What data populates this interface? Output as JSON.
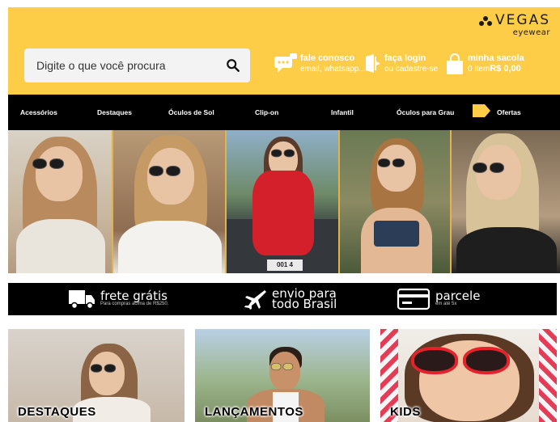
{
  "brand": {
    "name": "VEGAS",
    "tagline": "eyewear"
  },
  "search": {
    "placeholder": "Digite o que você procura"
  },
  "header_items": {
    "contact": {
      "title": "fale conosco",
      "subtitle": "email, whatsapp..."
    },
    "login": {
      "title": "faça login",
      "subtitle": "ou cadastre-se"
    },
    "bag": {
      "title": "minha sacola",
      "count": "0 item",
      "total": "R$ 0,00"
    }
  },
  "nav": {
    "items": [
      "Acessórios",
      "Destaques",
      "Óculos de Sol",
      "Clip-on",
      "Infantil",
      "Óculos para Grau",
      "Ofertas"
    ]
  },
  "banner": {
    "plate_text": "001 4"
  },
  "promo": {
    "free_shipping": {
      "title": "frete grátis",
      "subtitle": "Para compras acima de R$250."
    },
    "shipping": {
      "title_line1": "envio para",
      "title_line2": "todo Brasil"
    },
    "installments": {
      "title": "parcele",
      "subtitle": "em até 5x"
    }
  },
  "categories": [
    "DESTAQUES",
    "LANÇAMENTOS",
    "KIDS"
  ],
  "colors": {
    "header_bg": "#fecd47",
    "nav_bg": "#000000",
    "accent": "#fecd47"
  },
  "icons": [
    "search-icon",
    "chat-icon",
    "login-door-icon",
    "shopping-bag-icon",
    "tag-icon",
    "truck-icon",
    "airplane-icon",
    "credit-card-icon"
  ]
}
